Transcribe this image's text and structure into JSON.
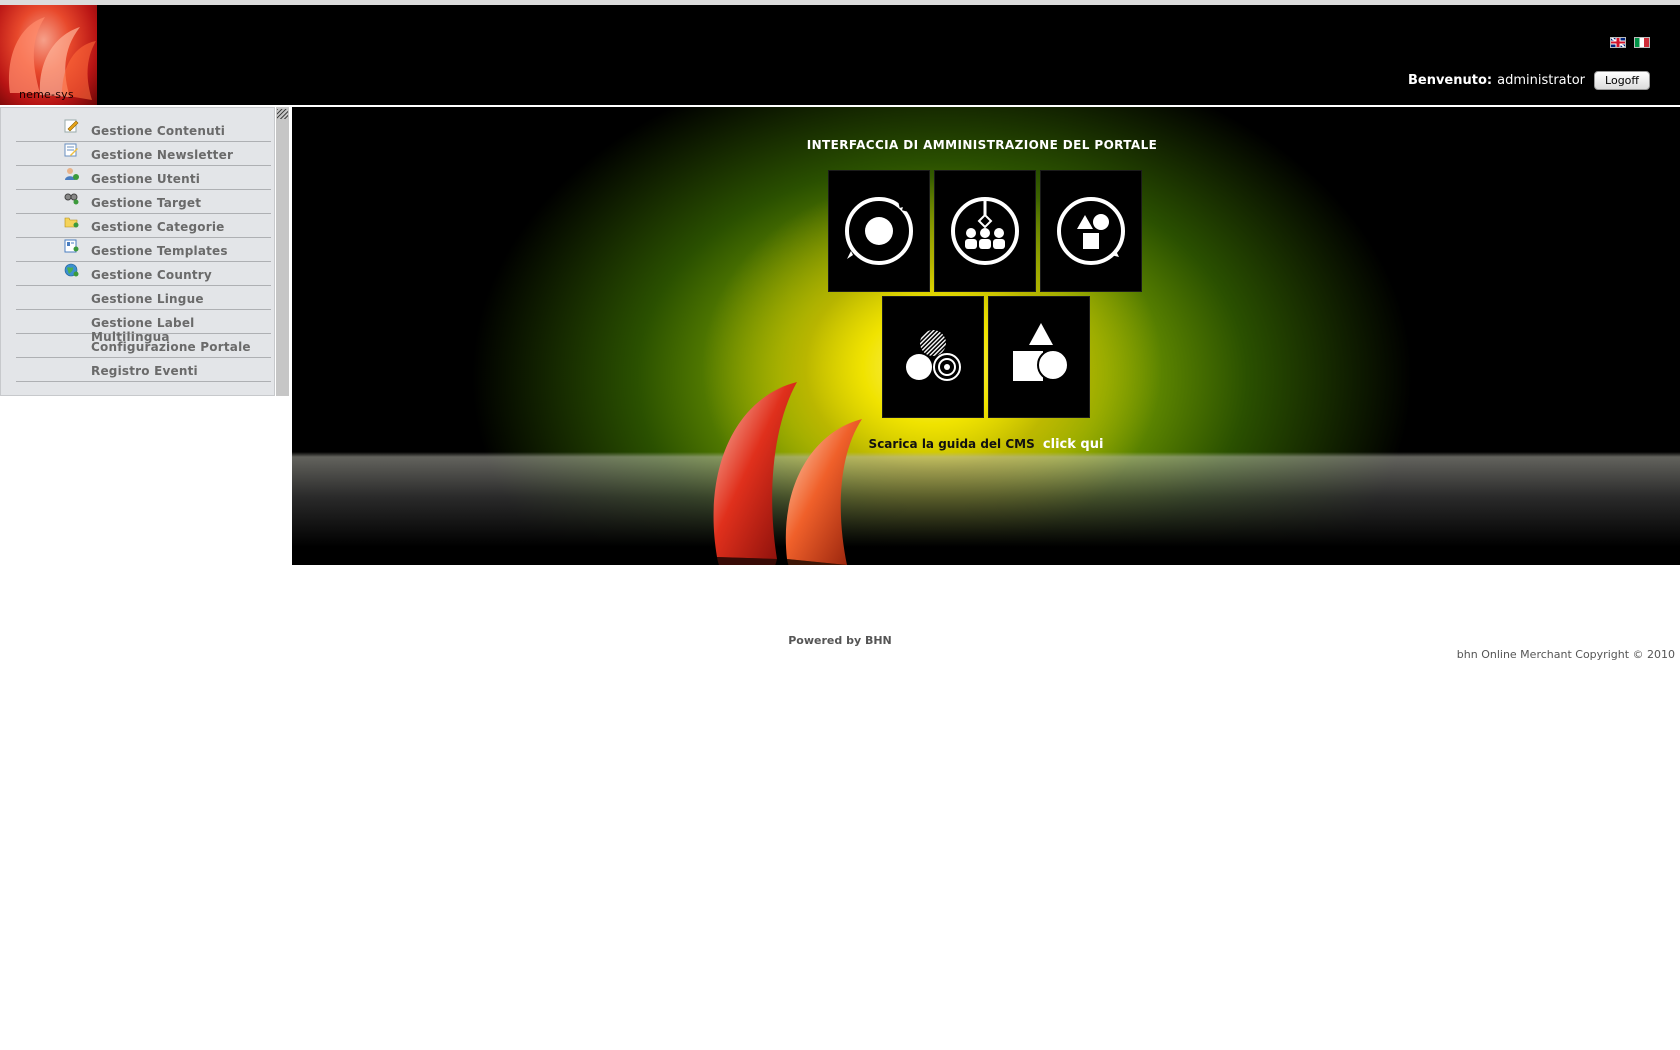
{
  "header": {
    "logo_text": "neme-sys",
    "languages": [
      "en",
      "it"
    ],
    "welcome_label": "Benvenuto:",
    "user_name": "administrator",
    "logoff_label": "Logoff"
  },
  "sidebar": {
    "items": [
      {
        "label": "Gestione Contenuti",
        "icon": "edit-icon"
      },
      {
        "label": "Gestione Newsletter",
        "icon": "newsletter-icon"
      },
      {
        "label": "Gestione Utenti",
        "icon": "users-icon"
      },
      {
        "label": "Gestione Target",
        "icon": "target-icon"
      },
      {
        "label": "Gestione Categorie",
        "icon": "folder-icon"
      },
      {
        "label": "Gestione Templates",
        "icon": "template-icon"
      },
      {
        "label": "Gestione Country",
        "icon": "globe-icon"
      },
      {
        "label": "Gestione Lingue",
        "icon": ""
      },
      {
        "label": "Gestione Label Multilingua",
        "icon": ""
      },
      {
        "label": "Configurazione Portale",
        "icon": ""
      },
      {
        "label": "Registro Eventi",
        "icon": ""
      }
    ]
  },
  "hero": {
    "title": "INTERFACCIA DI AMMINISTRAZIONE DEL PORTALE",
    "tiles": [
      "content-cycle-icon",
      "users-hierarchy-icon",
      "shapes-cycle-icon",
      "circles-icon",
      "shapes-icon"
    ],
    "guide_text": "Scarica la guida del CMS",
    "guide_link": "click qui"
  },
  "footer": {
    "powered": "Powered by BHN",
    "copyright": "bhn Online Merchant Copyright © 2010"
  }
}
